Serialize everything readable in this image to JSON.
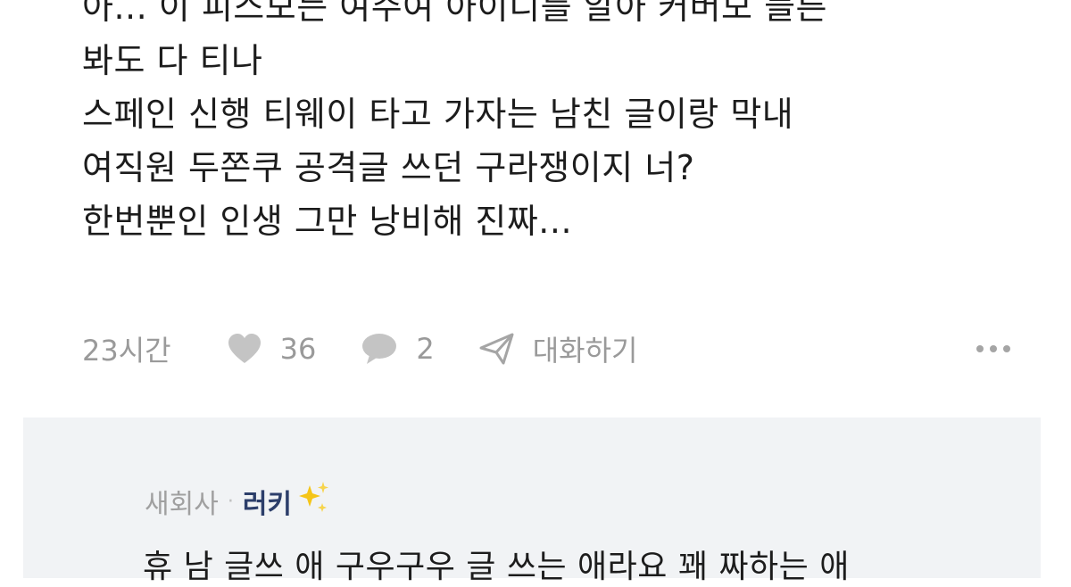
{
  "post": {
    "lines": [
      "아... 이 피스모든 여주여 아이디를 알아 커버모 들른",
      "봐도 다 티나",
      "스페인 신행 티웨이 타고 가자는 남친 글이랑 막내",
      "여직원 두쫀쿠 공격글 쓰던 구라쟁이지 너?",
      "한번뿐인 인생 그만 낭비해 진짜..."
    ]
  },
  "meta": {
    "time": "23시간",
    "likes": "36",
    "comments": "2",
    "chat_label": "대화하기"
  },
  "reply": {
    "company": "새회사",
    "separator": "·",
    "nickname": "러키",
    "text": "휴 남 글쓰 애 구우구우 글 쓰는 애라요 꽤 짜하는 애"
  },
  "icons": {
    "like": "heart-icon",
    "comment": "comment-bubble-icon",
    "chat": "paper-plane-icon",
    "more": "more-dots-icon",
    "sparkle": "sparkles-icon"
  },
  "colors": {
    "text": "#1c1c1c",
    "meta": "#9a9a9a",
    "reply_bg": "#f1f3f5",
    "nickname": "#2c3e6a"
  }
}
